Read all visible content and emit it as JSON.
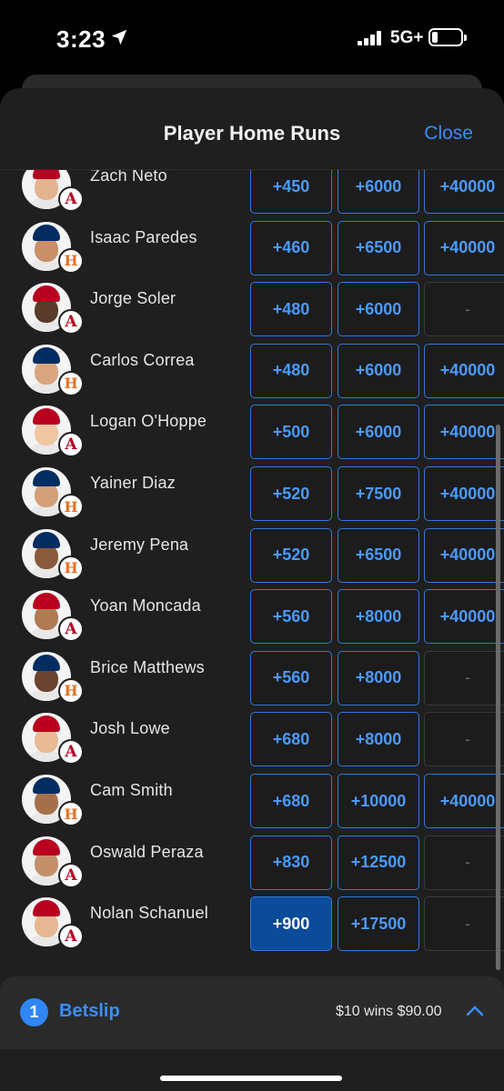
{
  "status_bar": {
    "time": "3:23",
    "network": "5G+"
  },
  "sheet": {
    "title": "Player Home Runs",
    "close_label": "Close"
  },
  "players": [
    {
      "name": "Zach Neto",
      "team": "A",
      "odds": [
        "+450",
        "+6000",
        "+40000"
      ]
    },
    {
      "name": "Isaac Paredes",
      "team": "H",
      "odds": [
        "+460",
        "+6500",
        "+40000"
      ]
    },
    {
      "name": "Jorge Soler",
      "team": "A",
      "odds": [
        "+480",
        "+6000",
        "-"
      ]
    },
    {
      "name": "Carlos Correa",
      "team": "H",
      "odds": [
        "+480",
        "+6000",
        "+40000"
      ]
    },
    {
      "name": "Logan O'Hoppe",
      "team": "A",
      "odds": [
        "+500",
        "+6000",
        "+40000"
      ]
    },
    {
      "name": "Yainer Diaz",
      "team": "H",
      "odds": [
        "+520",
        "+7500",
        "+40000"
      ]
    },
    {
      "name": "Jeremy Pena",
      "team": "H",
      "odds": [
        "+520",
        "+6500",
        "+40000"
      ]
    },
    {
      "name": "Yoan Moncada",
      "team": "A",
      "odds": [
        "+560",
        "+8000",
        "+40000"
      ]
    },
    {
      "name": "Brice Matthews",
      "team": "H",
      "odds": [
        "+560",
        "+8000",
        "-"
      ]
    },
    {
      "name": "Josh Lowe",
      "team": "A",
      "odds": [
        "+680",
        "+8000",
        "-"
      ]
    },
    {
      "name": "Cam Smith",
      "team": "H",
      "odds": [
        "+680",
        "+10000",
        "+40000"
      ]
    },
    {
      "name": "Oswald Peraza",
      "team": "A",
      "odds": [
        "+830",
        "+12500",
        "-"
      ]
    },
    {
      "name": "Nolan Schanuel",
      "team": "A",
      "odds": [
        "+900",
        "+17500",
        "-"
      ],
      "selected": 0
    }
  ],
  "betslip": {
    "count": "1",
    "label": "Betslip",
    "summary": "$10 wins $90.00"
  },
  "colors": {
    "accent": "#3a8ef6",
    "odds_border": "#2f7bdb",
    "selected_bg": "#0c4a9a",
    "angels_red": "#ba0021",
    "astros_orange": "#eb6e1f",
    "astros_navy": "#002d62"
  }
}
